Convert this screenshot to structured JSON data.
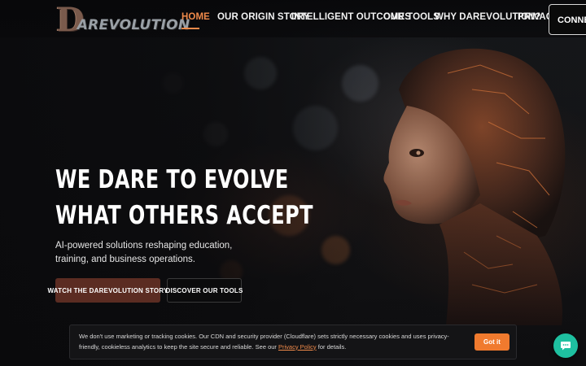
{
  "brand": {
    "logo_letter": "D",
    "logo_text": "AREVOLUTION"
  },
  "nav": {
    "items": [
      {
        "label": "HOME",
        "active": true
      },
      {
        "label": "OUR ORIGIN STORY",
        "active": false
      },
      {
        "label": "INTELLIGENT OUTCOMES",
        "active": false
      },
      {
        "label": "OUR TOOLS",
        "active": false
      },
      {
        "label": "WHY DAREVOLUTION?",
        "active": false
      },
      {
        "label": "PRIVACY",
        "active": false
      }
    ],
    "cta_label": "CONNECT W"
  },
  "hero": {
    "headline_line1": "WE DARE TO EVOLVE",
    "headline_line2": "WHAT OTHERS ACCEPT",
    "subtitle": "AI-powered solutions reshaping education, training, and business operations.",
    "primary_button": "WATCH THE DAREVOLUTION STORY",
    "secondary_button": "DISCOVER OUR TOOLS"
  },
  "cookie_banner": {
    "text_before_link": "We don't use marketing or tracking cookies. Our CDN and security provider (Cloudflare) sets strictly necessary cookies and uses privacy-friendly, cookieless analytics to keep the site secure and reliable. See our ",
    "link_label": "Privacy Policy",
    "text_after_link": " for details.",
    "accept_label": "Got it"
  },
  "chat": {
    "icon": "chat-bubble-icon"
  },
  "colors": {
    "accent": "#f08a4a",
    "primary_button": "#5b2c22",
    "cookie_button": "#f07a2e",
    "chat_button": "#1ec0a0"
  }
}
